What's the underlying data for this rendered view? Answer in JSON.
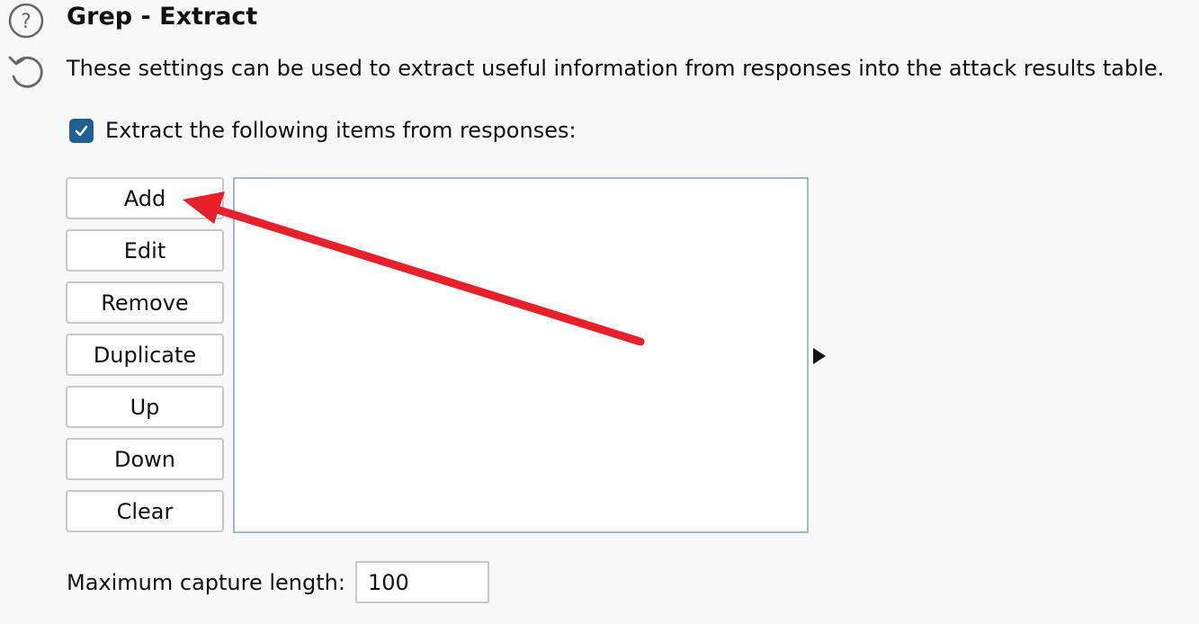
{
  "header": {
    "title": "Grep - Extract",
    "description": "These settings can be used to extract useful information from responses into the attack results table."
  },
  "icons": {
    "help": "help-icon",
    "reset": "reset-icon",
    "checkmark": "checkmark-icon",
    "resize": "resize-handle-icon",
    "annotation": "red-arrow-annotation"
  },
  "extract_option": {
    "label": "Extract the following items from responses:",
    "checked": true
  },
  "buttons": {
    "add": "Add",
    "edit": "Edit",
    "remove": "Remove",
    "duplicate": "Duplicate",
    "up": "Up",
    "down": "Down",
    "clear": "Clear"
  },
  "items": [],
  "capture": {
    "label": "Maximum capture length:",
    "value": "100"
  },
  "colors": {
    "checkbox": "#1f5f94",
    "annotation_arrow": "#e8202a",
    "list_border": "#9db8d0",
    "background": "#f8f8f8"
  }
}
